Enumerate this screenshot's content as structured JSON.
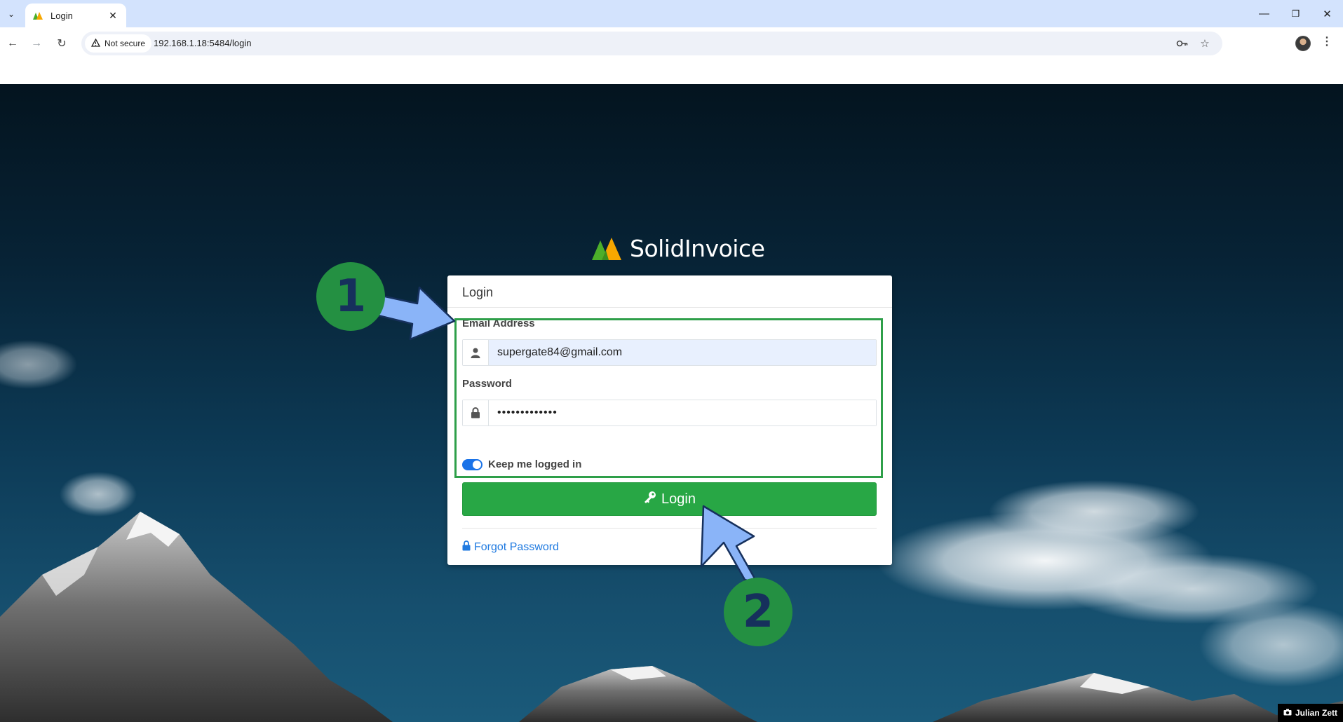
{
  "browser": {
    "tab_title": "Login",
    "security_label": "Not secure",
    "url": "192.168.1.18:5484/login"
  },
  "app": {
    "brand_name": "SolidInvoice",
    "card_title": "Login",
    "email_label": "Email Address",
    "email_value": "supergate84@gmail.com",
    "password_label": "Password",
    "password_value": "•••••••••••••",
    "remember_label": "Keep me logged in",
    "remember_checked": true,
    "login_button": "Login",
    "forgot_link": "Forgot Password",
    "colors": {
      "primary": "#28a745",
      "link": "#1f7ae0",
      "toggle": "#1a73e8"
    }
  },
  "annotations": {
    "step1": "1",
    "step2": "2",
    "highlight_color": "#2e9f49"
  },
  "credit": "Julian Zett"
}
